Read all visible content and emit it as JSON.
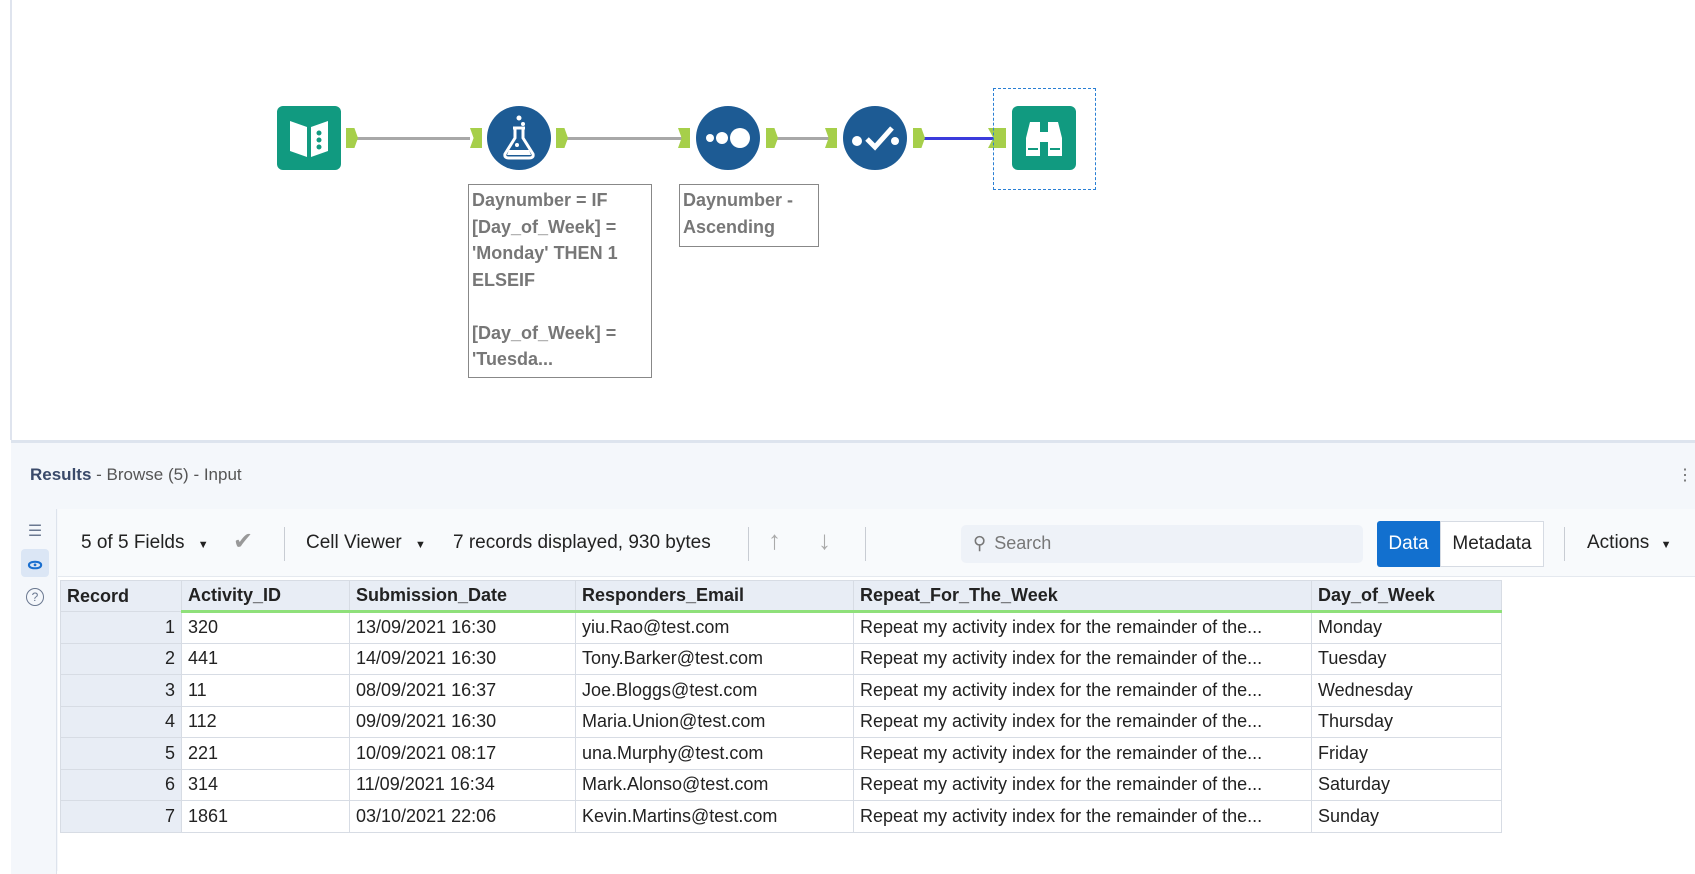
{
  "canvas": {
    "nodes": [
      {
        "name": "input-data-tool",
        "icon": "book-icon"
      },
      {
        "name": "formula-tool",
        "icon": "flask-icon"
      },
      {
        "name": "sort-tool",
        "icon": "dots-icon"
      },
      {
        "name": "select-tool",
        "icon": "check-icon"
      },
      {
        "name": "browse-tool",
        "icon": "binoculars-icon"
      }
    ],
    "annotations": {
      "formula": "Daynumber = IF\n[Day_of_Week] =\n'Monday' THEN 1\nELSEIF\n\n[Day_of_Week] =\n'Tuesda...",
      "sort": "Daynumber -\nAscending"
    },
    "colors": {
      "tool_blue": "#1d5b94",
      "tool_teal": "#119a80",
      "anchor": "#a6cf4a",
      "selected_wire": "#3b3bdc"
    }
  },
  "results": {
    "title": "Results",
    "subtitle": " - Browse (5) - Input",
    "toolbar": {
      "fields": "5 of 5 Fields",
      "cell_viewer": "Cell Viewer",
      "records_info": "7 records displayed, 930 bytes",
      "search_placeholder": "Search",
      "data": "Data",
      "metadata": "Metadata",
      "actions": "Actions"
    },
    "table": {
      "columns": [
        "Record",
        "Activity_ID",
        "Submission_Date",
        "Responders_Email",
        "Repeat_For_The_Week",
        "Day_of_Week"
      ],
      "rows": [
        [
          "1",
          "320",
          "13/09/2021 16:30",
          "yiu.Rao@test.com",
          "Repeat my activity index for the remainder of the...",
          "Monday"
        ],
        [
          "2",
          "441",
          "14/09/2021 16:30",
          "Tony.Barker@test.com",
          "Repeat my activity index for the remainder of the...",
          "Tuesday"
        ],
        [
          "3",
          "11",
          "08/09/2021 16:37",
          "Joe.Bloggs@test.com",
          "Repeat my activity index for the remainder of the...",
          "Wednesday"
        ],
        [
          "4",
          "112",
          "09/09/2021 16:30",
          "Maria.Union@test.com",
          "Repeat my activity index for the remainder of the...",
          "Thursday"
        ],
        [
          "5",
          "221",
          "10/09/2021 08:17",
          "una.Murphy@test.com",
          "Repeat my activity index for the remainder of the...",
          "Friday"
        ],
        [
          "6",
          "314",
          "11/09/2021 16:34",
          "Mark.Alonso@test.com",
          "Repeat my activity index for the remainder of the...",
          "Saturday"
        ],
        [
          "7",
          "1861",
          "03/10/2021 22:06",
          "Kevin.Martins@test.com",
          "Repeat my activity index for the remainder of the...",
          "Sunday"
        ]
      ]
    }
  }
}
